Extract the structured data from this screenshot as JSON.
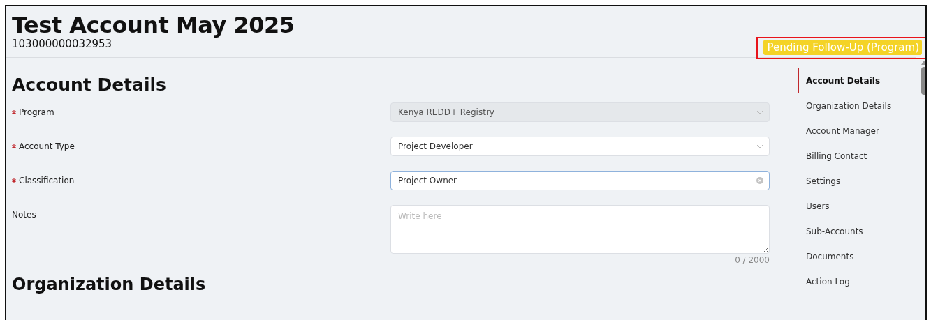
{
  "header": {
    "title": "Test Account May 2025",
    "account_number": "103000000032953",
    "status": {
      "label": "Pending Follow-Up (Program)",
      "highlighted": true
    }
  },
  "section": {
    "title": "Account Details",
    "fields": [
      {
        "kind": "select",
        "label": "Program",
        "required": true,
        "value": "Kenya REDD+ Registry",
        "disabled": true
      },
      {
        "kind": "select",
        "label": "Account Type",
        "required": true,
        "value": "Project Developer",
        "disabled": false
      },
      {
        "kind": "clearable",
        "label": "Classification",
        "required": true,
        "value": "Project Owner",
        "focused": true
      },
      {
        "kind": "textarea",
        "label": "Notes",
        "required": false,
        "placeholder": "Write here",
        "counter": "0 / 2000"
      }
    ]
  },
  "nav": {
    "items": [
      {
        "label": "Account Details",
        "selected": true
      },
      {
        "label": "Organization Details",
        "selected": false
      },
      {
        "label": "Account Manager",
        "selected": false
      },
      {
        "label": "Billing Contact",
        "selected": false
      },
      {
        "label": "Settings",
        "selected": false
      },
      {
        "label": "Users",
        "selected": false
      },
      {
        "label": "Sub-Accounts",
        "selected": false
      },
      {
        "label": "Documents",
        "selected": false
      },
      {
        "label": "Action Log",
        "selected": false
      }
    ]
  },
  "next_section": {
    "title": "Organization Details"
  }
}
